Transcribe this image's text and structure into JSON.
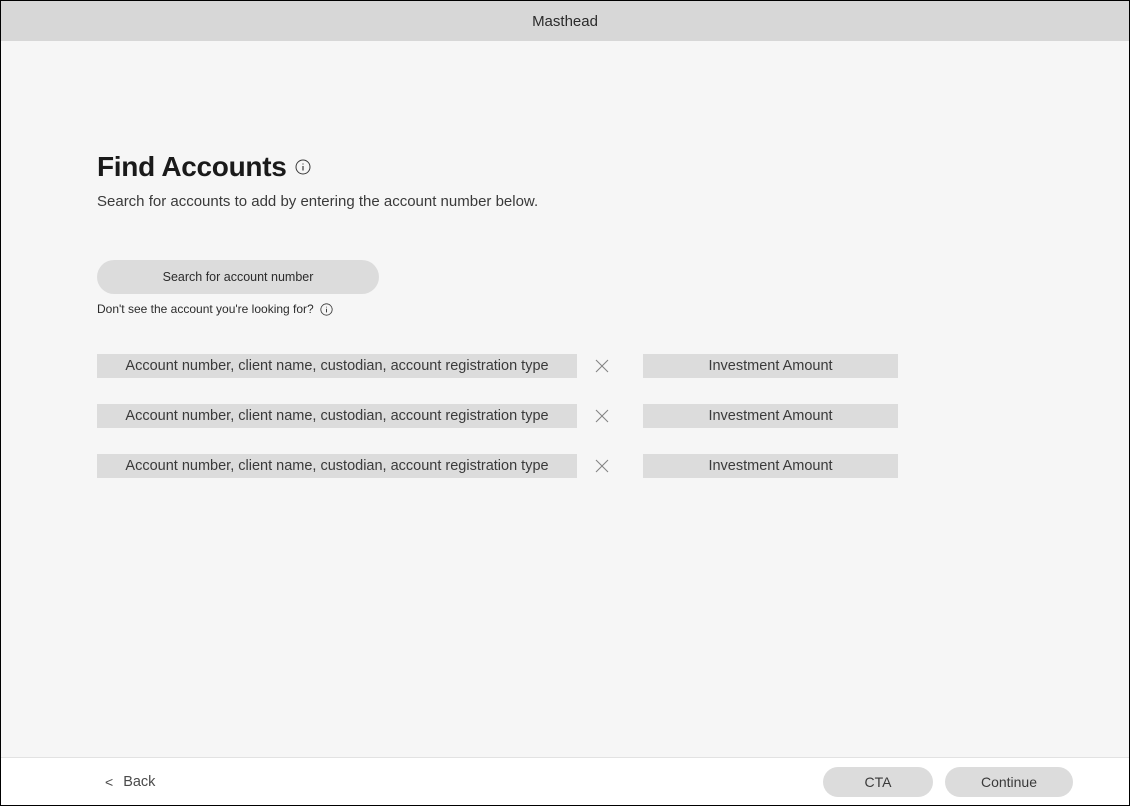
{
  "masthead": {
    "label": "Masthead"
  },
  "page": {
    "title": "Find Accounts",
    "subtitle": "Search for accounts to add by entering the account number below."
  },
  "search": {
    "placeholder": "Search for account number"
  },
  "help": {
    "text": "Don't see the account you're looking for?"
  },
  "account_rows": [
    {
      "account_text": "Account number, client name, custodian, account registration type",
      "investment_label": "Investment Amount"
    },
    {
      "account_text": "Account number, client name, custodian, account registration type",
      "investment_label": "Investment Amount"
    },
    {
      "account_text": "Account number, client name, custodian, account registration type",
      "investment_label": "Investment Amount"
    }
  ],
  "footer": {
    "back_label": "Back",
    "cta_label": "CTA",
    "continue_label": "Continue"
  }
}
